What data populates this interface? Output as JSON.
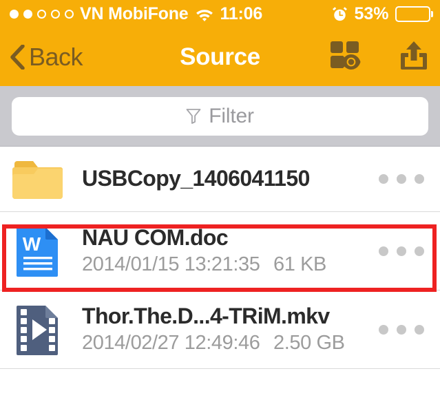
{
  "status_bar": {
    "signal_dots_total": 5,
    "signal_dots_filled": 2,
    "carrier": "VN MobiFone",
    "wifi_icon": "wifi-icon",
    "time": "11:06",
    "alarm_icon": "alarm-clock-icon",
    "battery_percent_label": "53%",
    "battery_level": 53,
    "background_color": "#F7AE08",
    "foreground_color": "#FFFFFF"
  },
  "nav_bar": {
    "back_label": "Back",
    "back_icon": "chevron-left-icon",
    "title": "Source",
    "view_icon": "grid-preview-icon",
    "share_icon": "share-upload-icon",
    "background_color": "#F7AE08",
    "title_color": "#FFFFFF",
    "back_color": "#7A5C22"
  },
  "filter_bar": {
    "icon": "funnel-icon",
    "placeholder": "Filter",
    "value": "",
    "background_color": "#C9C9CE"
  },
  "file_list": {
    "items": [
      {
        "name": "USBCopy_1406041150",
        "icon": "folder-icon",
        "type": "folder",
        "date": "",
        "size": "",
        "more_icon": "more-dots-icon"
      },
      {
        "name": "NAU COM.doc",
        "icon": "word-document-icon",
        "type": "document",
        "date": "2014/01/15 13:21:35",
        "size": "61 KB",
        "more_icon": "more-dots-icon",
        "highlighted": true
      },
      {
        "name": "Thor.The.D...4-TRiM.mkv",
        "icon": "video-file-icon",
        "type": "video",
        "date": "2014/02/27 12:49:46",
        "size": "2.50 GB",
        "more_icon": "more-dots-icon"
      }
    ]
  },
  "annotation": {
    "highlight_color": "#EE2222",
    "target": "NAU COM.doc"
  }
}
